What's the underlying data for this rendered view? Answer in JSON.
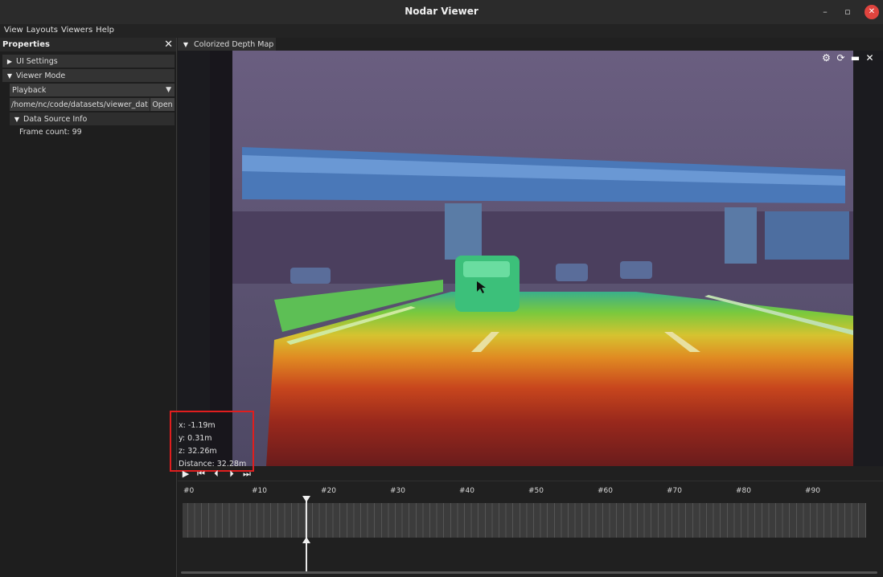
{
  "window": {
    "title": "Nodar Viewer",
    "min_glyph": "–",
    "max_glyph": "▫",
    "close_glyph": "✕"
  },
  "menu": [
    "View",
    "Layouts",
    "Viewers",
    "Help"
  ],
  "properties": {
    "title": "Properties",
    "close_glyph": "✕",
    "ui_settings": "UI Settings",
    "viewer_mode": "Viewer Mode",
    "playback_value": "Playback",
    "path_value": "/home/nc/code/datasets/viewer_dat",
    "open_label": "Open",
    "data_source_info": "Data Source Info",
    "frame_count": "Frame count: 99"
  },
  "viewer": {
    "tab_label": "Colorized Depth Map",
    "toolbar_icons": [
      "gear-icon",
      "refresh-icon",
      "maximize-icon",
      "close-icon"
    ]
  },
  "point_info": {
    "x": "x: -1.19m",
    "y": "y: 0.31m",
    "z": "z: 32.26m",
    "distance": "Distance: 32.28m"
  },
  "playback_controls": [
    "play-icon",
    "skip-to-start-icon",
    "step-back-icon",
    "step-forward-icon",
    "skip-to-end-icon"
  ],
  "timeline": {
    "labels": [
      "#0",
      "#10",
      "#20",
      "#30",
      "#40",
      "#50",
      "#60",
      "#70",
      "#80",
      "#90"
    ],
    "current_frame": 18,
    "total_frames": 99
  }
}
